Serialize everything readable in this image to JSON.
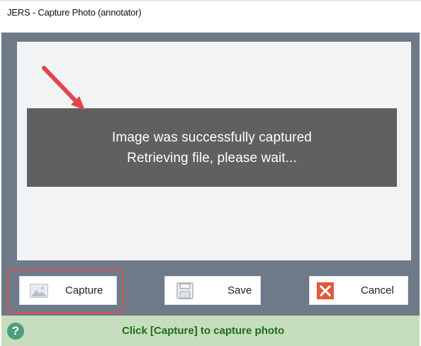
{
  "window": {
    "title": "JERS - Capture Photo (annotator)"
  },
  "preview": {
    "message_line1": "Image was successfully captured",
    "message_line2": "Retrieving file, please wait..."
  },
  "buttons": {
    "capture": {
      "label": "Capture",
      "icon": "image-icon"
    },
    "save": {
      "label": "Save",
      "icon": "floppy-disk-icon"
    },
    "cancel": {
      "label": "Cancel",
      "icon": "close-icon"
    }
  },
  "status": {
    "text": "Click [Capture] to capture photo",
    "icon": "help-icon"
  },
  "colors": {
    "client_bg": "#6e7a87",
    "message_bg": "#606060",
    "status_bg": "#c6ddbe",
    "status_text": "#1b6e16",
    "annotation": "#e0474c",
    "cancel_icon": "#e05a3a"
  }
}
